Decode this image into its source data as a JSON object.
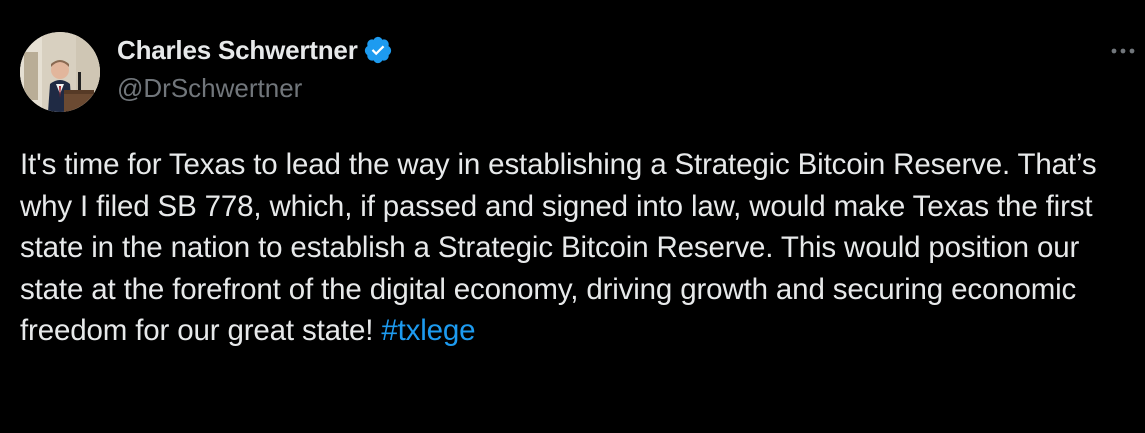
{
  "author": {
    "display_name": "Charles Schwertner",
    "handle": "@DrSchwertner",
    "verified": true
  },
  "tweet": {
    "body": "It's time for Texas to lead the way in establishing a Strategic Bitcoin Reserve. That’s why I filed SB 778, which, if passed and signed into law, would make Texas the first state in the nation to establish a Strategic Bitcoin Reserve. This would position our state at the forefront of the digital economy, driving growth and securing economic freedom for our great state! ",
    "hashtag": "#txlege"
  },
  "icons": {
    "verified": "verified-badge-icon",
    "more": "more-options-icon"
  },
  "colors": {
    "background": "#000000",
    "text": "#e7e9ea",
    "secondary": "#71767b",
    "accent": "#1d9bf0"
  }
}
